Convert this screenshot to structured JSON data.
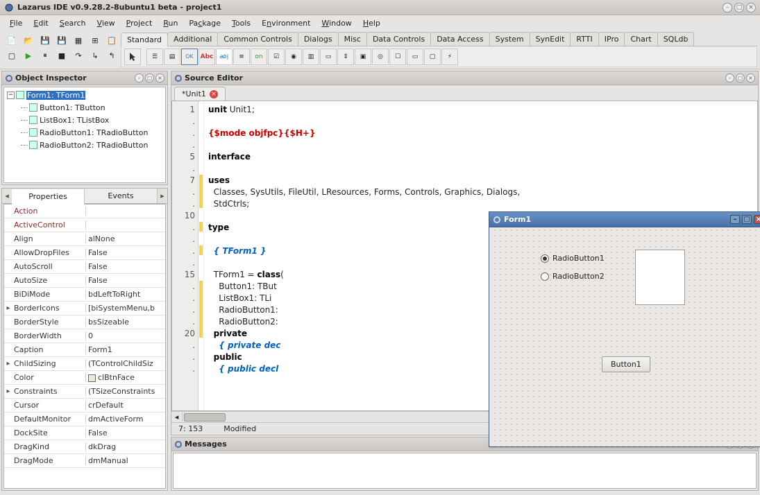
{
  "window": {
    "title": "Lazarus IDE v0.9.28.2-8ubuntu1 beta - project1"
  },
  "menus": [
    "File",
    "Edit",
    "Search",
    "View",
    "Project",
    "Run",
    "Package",
    "Tools",
    "Environment",
    "Window",
    "Help"
  ],
  "compTabs": [
    "Standard",
    "Additional",
    "Common Controls",
    "Dialogs",
    "Misc",
    "Data Controls",
    "Data Access",
    "System",
    "SynEdit",
    "RTTI",
    "IPro",
    "Chart",
    "SQLdb"
  ],
  "compActiveTab": "Standard",
  "inspector": {
    "title": "Object Inspector",
    "root": "Form1: TForm1",
    "children": [
      "Button1: TButton",
      "ListBox1: TListBox",
      "RadioButton1: TRadioButton",
      "RadioButton2: TRadioButton"
    ],
    "tabs": [
      "Properties",
      "Events"
    ],
    "activeTab": "Properties",
    "props": [
      {
        "n": "Action",
        "v": "",
        "s": "r",
        "e": false
      },
      {
        "n": "ActiveControl",
        "v": "",
        "s": "r",
        "e": false
      },
      {
        "n": "Align",
        "v": "alNone",
        "s": "",
        "e": false
      },
      {
        "n": "AllowDropFiles",
        "v": "False",
        "s": "",
        "e": false
      },
      {
        "n": "AutoScroll",
        "v": "False",
        "s": "",
        "e": false
      },
      {
        "n": "AutoSize",
        "v": "False",
        "s": "",
        "e": false
      },
      {
        "n": "BiDiMode",
        "v": "bdLeftToRight",
        "s": "",
        "e": false
      },
      {
        "n": "BorderIcons",
        "v": "[biSystemMenu,b",
        "s": "",
        "e": true
      },
      {
        "n": "BorderStyle",
        "v": "bsSizeable",
        "s": "",
        "e": false
      },
      {
        "n": "BorderWidth",
        "v": "0",
        "s": "",
        "e": false
      },
      {
        "n": "Caption",
        "v": "Form1",
        "s": "",
        "e": false
      },
      {
        "n": "ChildSizing",
        "v": "(TControlChildSiz",
        "s": "",
        "e": true
      },
      {
        "n": "Color",
        "v": "clBtnFace",
        "s": "",
        "e": false,
        "swatch": true
      },
      {
        "n": "Constraints",
        "v": "(TSizeConstraints",
        "s": "",
        "e": true
      },
      {
        "n": "Cursor",
        "v": "crDefault",
        "s": "",
        "e": false
      },
      {
        "n": "DefaultMonitor",
        "v": "dmActiveForm",
        "s": "",
        "e": false
      },
      {
        "n": "DockSite",
        "v": "False",
        "s": "",
        "e": false
      },
      {
        "n": "DragKind",
        "v": "dkDrag",
        "s": "",
        "e": false
      },
      {
        "n": "DragMode",
        "v": "dmManual",
        "s": "",
        "e": false
      }
    ]
  },
  "source": {
    "title": "Source Editor",
    "tab": "*Unit1",
    "gutter": [
      "1",
      ".",
      ".",
      ".",
      "5",
      ".",
      "7",
      ".",
      ".",
      "10",
      ".",
      ".",
      ".",
      ".",
      "15",
      ".",
      ".",
      ".",
      ".",
      "20",
      ".",
      ".",
      "."
    ],
    "status": {
      "pos": "7: 153",
      "mod": "Modified"
    }
  },
  "messages": {
    "title": "Messages"
  },
  "designer": {
    "title": "Form1",
    "radio1": "RadioButton1",
    "radio2": "RadioButton2",
    "button": "Button1"
  }
}
